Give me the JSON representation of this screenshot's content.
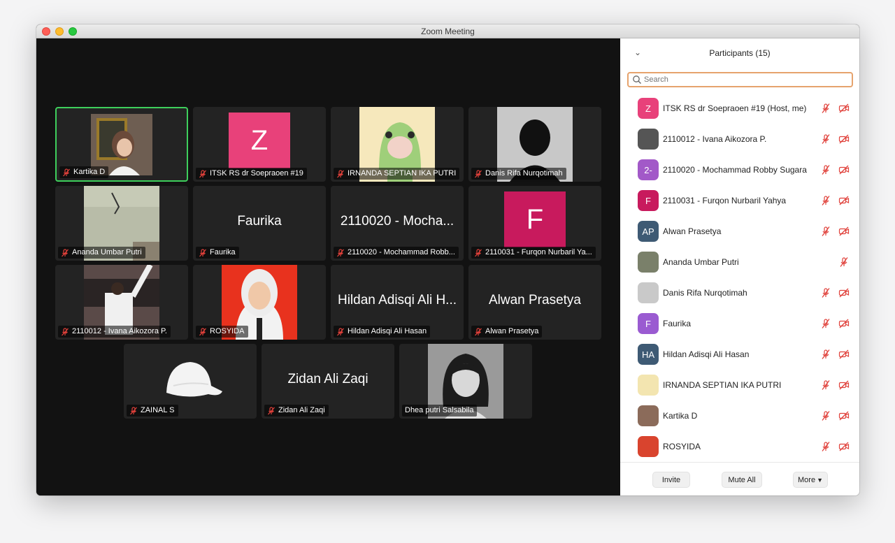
{
  "window": {
    "title": "Zoom Meeting"
  },
  "gallery": {
    "tiles": [
      {
        "name": "Kartika D",
        "big": ""
      },
      {
        "name": "ITSK RS dr Soepraoen #19",
        "big": "",
        "letter": "Z"
      },
      {
        "name": "IRNANDA SEPTIAN IKA PUTRI",
        "big": ""
      },
      {
        "name": "Danis Rifa Nurqotimah",
        "big": ""
      },
      {
        "name": "Ananda Umbar Putri",
        "big": ""
      },
      {
        "name": "Faurika",
        "big": "Faurika"
      },
      {
        "name": "2110020 - Mochammad Robb...",
        "big": "2110020 - Mocha..."
      },
      {
        "name": "2110031 - Furqon Nurbaril Ya...",
        "big": "",
        "letter": "F"
      },
      {
        "name": "2110012  - Ivana Aikozora P.",
        "big": ""
      },
      {
        "name": "ROSYIDA",
        "big": ""
      },
      {
        "name": "Hildan Adisqi Ali Hasan",
        "big": "Hildan Adisqi Ali H..."
      },
      {
        "name": "Alwan Prasetya",
        "big": "Alwan Prasetya"
      },
      {
        "name": "ZAINAL S",
        "big": ""
      },
      {
        "name": "Zidan Ali Zaqi",
        "big": "Zidan Ali Zaqi"
      },
      {
        "name": "Dhea putri Salsabila",
        "big": ""
      }
    ]
  },
  "participants": {
    "title": "Participants (15)",
    "search_placeholder": "Search",
    "items": [
      {
        "name": "ITSK RS dr Soepraoen #19 (Host, me)",
        "initials": "Z",
        "color": "#e8417a"
      },
      {
        "name": "2110012  - Ivana Aikozora P.",
        "initials": "",
        "color": "#555555"
      },
      {
        "name": "2110020 - Mochammad Robby Sugara",
        "initials": "2-",
        "color": "#a259c8"
      },
      {
        "name": "2110031 - Furqon Nurbaril Yahya",
        "initials": "F",
        "color": "#c81a5d"
      },
      {
        "name": "Alwan Prasetya",
        "initials": "AP",
        "color": "#3e5a74"
      },
      {
        "name": "Ananda Umbar Putri",
        "initials": "",
        "color": "#7a806a"
      },
      {
        "name": "Danis Rifa Nurqotimah",
        "initials": "",
        "color": "#c9c9c9"
      },
      {
        "name": "Faurika",
        "initials": "F",
        "color": "#9a5bd1"
      },
      {
        "name": "Hildan Adisqi Ali Hasan",
        "initials": "HA",
        "color": "#3e5a74"
      },
      {
        "name": "IRNANDA SEPTIAN IKA PUTRI",
        "initials": "",
        "color": "#f3e5b0"
      },
      {
        "name": "Kartika D",
        "initials": "",
        "color": "#8b6b5a"
      },
      {
        "name": "ROSYIDA",
        "initials": "",
        "color": "#d9442e"
      }
    ],
    "buttons": {
      "invite": "Invite",
      "mute_all": "Mute All",
      "more": "More"
    }
  },
  "colors": {
    "muted_red": "#e0403a",
    "accent_green": "#3ecf5c",
    "search_focus": "#e6a36d"
  }
}
